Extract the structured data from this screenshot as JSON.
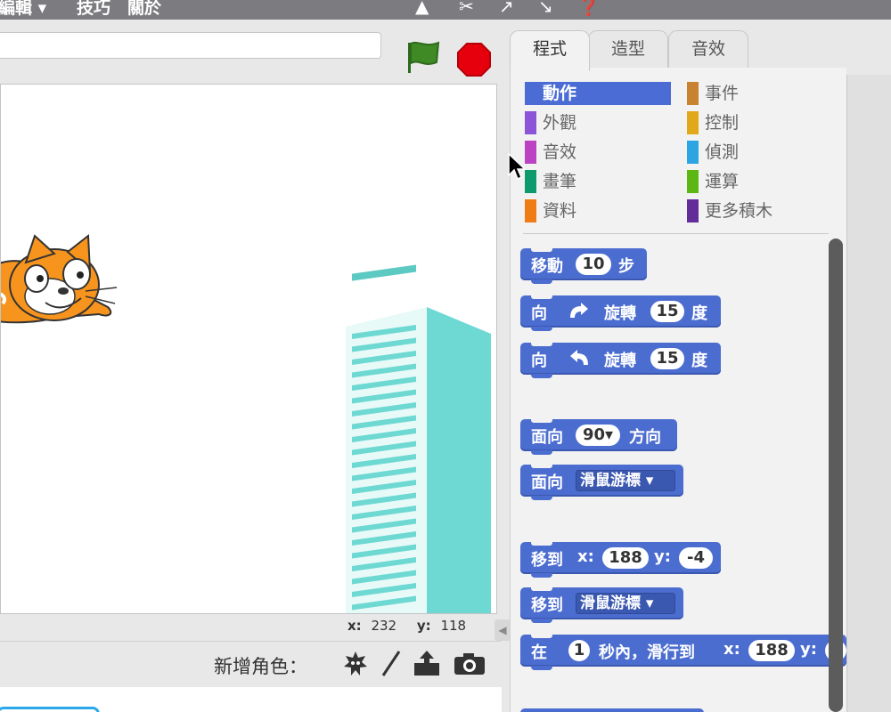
{
  "menubar": {
    "edit_label": "編輯 ▾",
    "tips_label": "技巧",
    "about_label": "關於",
    "icons": [
      "duplicate-stamp-icon",
      "cut-icon",
      "grow-icon",
      "shrink-icon",
      "help-icon"
    ]
  },
  "stage": {
    "flag_icon": "green-flag-icon",
    "stop_icon": "stop-sign-icon",
    "mouse_x_label": "x:",
    "mouse_x": "232",
    "mouse_y_label": "y:",
    "mouse_y": "118"
  },
  "sprites": {
    "new_sprite_label": "新增角色：",
    "icons": [
      "choose-sprite-from-library-icon",
      "paint-new-sprite-icon",
      "upload-sprite-icon",
      "camera-sprite-icon"
    ]
  },
  "tabs": [
    {
      "label": "程式",
      "active": true
    },
    {
      "label": "造型",
      "active": false
    },
    {
      "label": "音效",
      "active": false
    }
  ],
  "categories": [
    {
      "label": "動作",
      "color": "#4a6cd4",
      "active": true
    },
    {
      "label": "外觀",
      "color": "#8a55d7",
      "active": false
    },
    {
      "label": "音效",
      "color": "#bb42c3",
      "active": false
    },
    {
      "label": "畫筆",
      "color": "#0e9a6c",
      "active": false
    },
    {
      "label": "資料",
      "color": "#ee7d16",
      "active": false
    },
    {
      "label": "事件",
      "color": "#c88330",
      "active": false
    },
    {
      "label": "控制",
      "color": "#e1a91a",
      "active": false
    },
    {
      "label": "偵測",
      "color": "#2ca5e2",
      "active": false
    },
    {
      "label": "運算",
      "color": "#5cb712",
      "active": false
    },
    {
      "label": "更多積木",
      "color": "#632d99",
      "active": false
    }
  ],
  "blocks": {
    "move": {
      "label": "移動",
      "steps": "10",
      "unit": "步"
    },
    "turn_cw": {
      "label": "向",
      "action": "旋轉",
      "degrees": "15",
      "unit": "度"
    },
    "turn_ccw": {
      "label": "向",
      "action": "旋轉",
      "degrees": "15",
      "unit": "度"
    },
    "point_direction": {
      "label": "面向",
      "value": "90▾",
      "unit": "方向"
    },
    "point_towards": {
      "label": "面向",
      "option": "滑鼠游標"
    },
    "go_to_xy": {
      "label": "移到",
      "x_label": "x:",
      "x": "188",
      "y_label": "y:",
      "y": "-4"
    },
    "go_to": {
      "label": "移到",
      "option": "滑鼠游標"
    },
    "glide": {
      "label": "在",
      "secs": "1",
      "text": "秒內，滑行到",
      "x_label": "x:",
      "x": "188",
      "y_label": "y:"
    }
  },
  "colors": {
    "motion": "#4c6dd0",
    "tab_active_bg": "#f2f2f2",
    "building": "#6ed8d2"
  }
}
